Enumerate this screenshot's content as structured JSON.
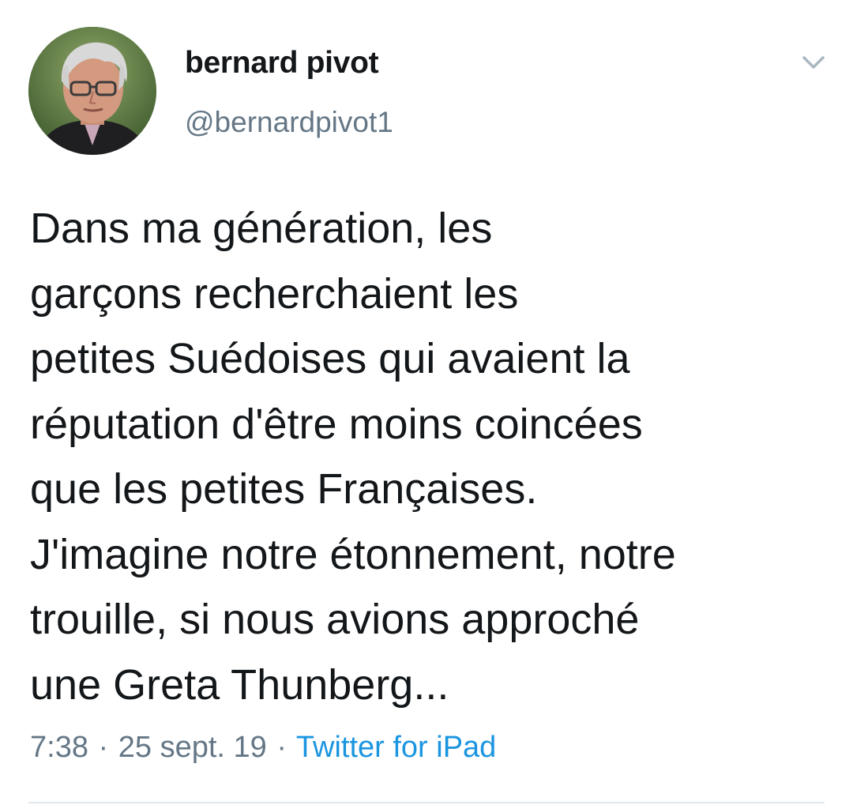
{
  "tweet": {
    "author": {
      "display_name": "bernard pivot",
      "handle": "@bernardpivot1",
      "avatar_icon": "profile-photo"
    },
    "menu_icon": "chevron-down-icon",
    "text_lines": [
      "Dans ma génération, les",
      "garçons recherchaient les",
      "petites Suédoises qui avaient la",
      "réputation d'être moins coincées",
      "que les petites Françaises.",
      "J'imagine notre étonnement, notre",
      "trouille, si nous avions approché",
      "une Greta Thunberg..."
    ],
    "time": "7:38",
    "separator": "·",
    "date": "25 sept. 19",
    "source": "Twitter for iPad"
  },
  "colors": {
    "text_primary": "#14171a",
    "text_secondary": "#657786",
    "link": "#1b95e0",
    "divider": "#e1e8ed"
  }
}
